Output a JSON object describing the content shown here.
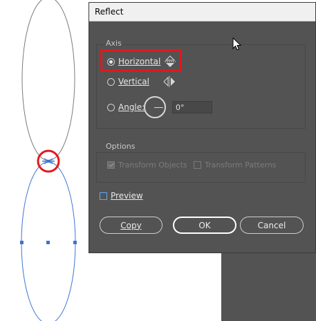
{
  "window": {
    "title": "Reflect"
  },
  "axis": {
    "label": "Axis",
    "options": [
      {
        "label": "Horizontal",
        "selected": true,
        "icon": "reflect-horizontal-icon"
      },
      {
        "label": "Vertical",
        "selected": false,
        "icon": "reflect-vertical-icon"
      },
      {
        "label": "Angle:",
        "selected": false,
        "icon": "angle-dial-icon"
      }
    ],
    "angle_value": "0°"
  },
  "options": {
    "label": "Options",
    "transform_objects": {
      "label": "Transform Objects",
      "checked": true,
      "enabled": false
    },
    "transform_patterns": {
      "label": "Transform Patterns",
      "checked": false,
      "enabled": false
    }
  },
  "preview": {
    "label": "Preview",
    "checked": false
  },
  "buttons": {
    "copy": "Copy",
    "ok": "OK",
    "cancel": "Cancel"
  },
  "colors": {
    "dialog_bg": "#535353",
    "highlight": "#e3171c",
    "selection": "#3b74d3",
    "preview_checkbox": "#5fa8f5"
  }
}
